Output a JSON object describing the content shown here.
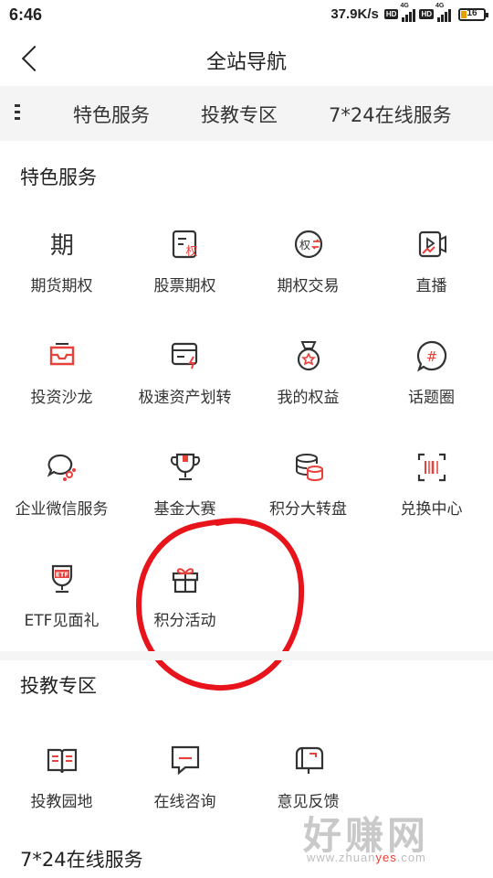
{
  "status_bar": {
    "time": "6:46",
    "speed": "37.9K/s",
    "hd": "HD",
    "net": "4G",
    "battery": "16"
  },
  "header": {
    "title": "全站导航"
  },
  "tabs": [
    "特色服务",
    "投教专区",
    "7*24在线服务"
  ],
  "sections": {
    "featured": {
      "title": "特色服务",
      "items": [
        {
          "label": "期货期权",
          "icon": "futures-icon"
        },
        {
          "label": "股票期权",
          "icon": "stock-option-icon"
        },
        {
          "label": "期权交易",
          "icon": "option-trade-icon"
        },
        {
          "label": "直播",
          "icon": "live-icon"
        },
        {
          "label": "投资沙龙",
          "icon": "salon-icon"
        },
        {
          "label": "极速资产划转",
          "icon": "transfer-icon"
        },
        {
          "label": "我的权益",
          "icon": "medal-icon"
        },
        {
          "label": "话题圈",
          "icon": "topic-icon"
        },
        {
          "label": "企业微信服务",
          "icon": "wechat-icon"
        },
        {
          "label": "基金大赛",
          "icon": "trophy-icon"
        },
        {
          "label": "积分大转盘",
          "icon": "coins-icon"
        },
        {
          "label": "兑换中心",
          "icon": "scan-icon"
        },
        {
          "label": "ETF见面礼",
          "icon": "etf-icon"
        },
        {
          "label": "积分活动",
          "icon": "gift-icon"
        }
      ]
    },
    "education": {
      "title": "投教专区",
      "items": [
        {
          "label": "投教园地",
          "icon": "book-icon"
        },
        {
          "label": "在线咨询",
          "icon": "chat-icon"
        },
        {
          "label": "意见反馈",
          "icon": "mailbox-icon"
        }
      ]
    },
    "online": {
      "title": "7*24在线服务"
    }
  },
  "watermark": {
    "main": "好赚网",
    "prefix": "www.zhuan",
    "highlight": "yes",
    "suffix": ".com"
  },
  "colors": {
    "accent": "#e8403a",
    "annotation": "#e8141c",
    "icon_stroke": "#333333"
  }
}
